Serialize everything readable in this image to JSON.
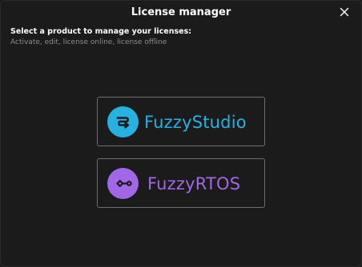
{
  "window": {
    "title": "License manager",
    "close_icon": "close-icon"
  },
  "content": {
    "heading": "Select a product to manage your licenses:",
    "subheading": "Activate, edit, license online, license offline"
  },
  "products": [
    {
      "name": "FuzzyStudio",
      "icon": "fuzzystudio-logo-icon",
      "color": "#27b1e0"
    },
    {
      "name": "FuzzyRTOS",
      "icon": "fuzzyrtos-logo-icon",
      "color": "#a267e6"
    }
  ]
}
